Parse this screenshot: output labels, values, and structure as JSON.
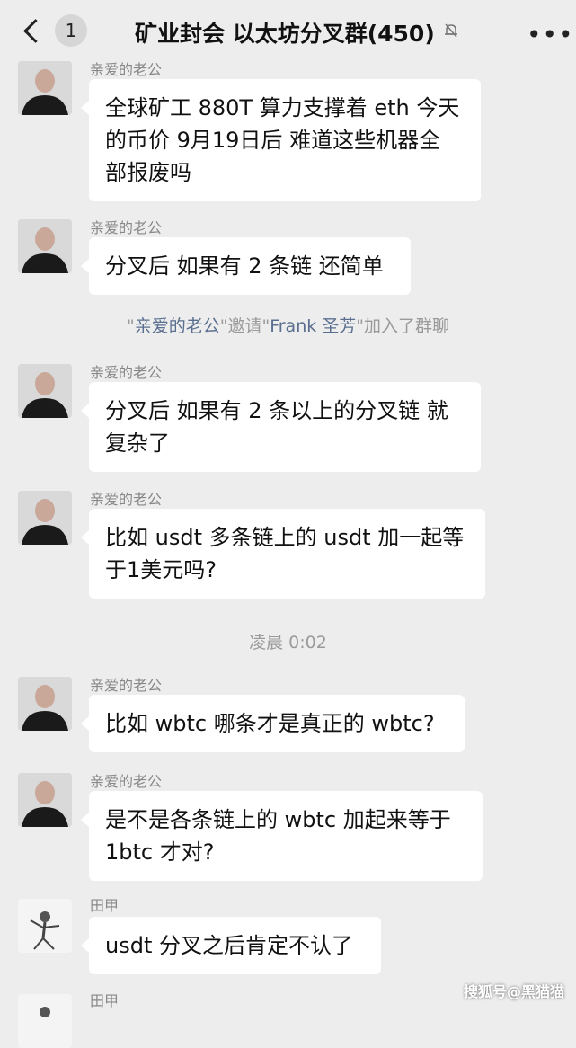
{
  "header": {
    "back_badge": "1",
    "title": "矿业封会 以太坊分叉群(450)",
    "more_label": "•••"
  },
  "colors": {
    "background": "#ededed",
    "bubble": "#ffffff",
    "system_highlight": "#5a6f8f"
  },
  "messages": [
    {
      "sender": "亲爱的老公",
      "text_lines": [
        "全球矿工 880T 算力支撑着 eth 今天",
        "的币价 9月19日后 难道这些机器全",
        "部报废吗"
      ],
      "avatar": "man-avatar"
    },
    {
      "sender": "亲爱的老公",
      "text_lines": [
        "分叉后 如果有 2 条链 还简单"
      ],
      "avatar": "man-avatar"
    },
    {
      "sender": "亲爱的老公",
      "text_lines": [
        "分叉后 如果有 2 条以上的分叉链 就",
        "复杂了"
      ],
      "avatar": "man-avatar"
    },
    {
      "sender": "亲爱的老公",
      "text_lines": [
        "比如 usdt 多条链上的 usdt 加一起等",
        "于1美元吗?"
      ],
      "avatar": "man-avatar"
    },
    {
      "sender": "亲爱的老公",
      "text_lines": [
        "比如 wbtc 哪条才是真正的 wbtc?"
      ],
      "avatar": "man-avatar"
    },
    {
      "sender": "亲爱的老公",
      "text_lines": [
        "是不是各条链上的 wbtc 加起来等于",
        "1btc 才对?"
      ],
      "avatar": "man-avatar"
    },
    {
      "sender": "田甲",
      "text_lines": [
        "usdt 分叉之后肯定不认了"
      ],
      "avatar": "figure-avatar"
    },
    {
      "sender": "田甲",
      "text_lines": [],
      "avatar": "figure-avatar"
    }
  ],
  "system_message": {
    "q1": "\"",
    "name1": "亲爱的老公",
    "q2": "\"邀请\"",
    "name2": "Frank 圣芳",
    "q3": "\"加入了群聊"
  },
  "timestamp": "凌晨 0:02",
  "watermark": "搜狐号@黑猫猫"
}
